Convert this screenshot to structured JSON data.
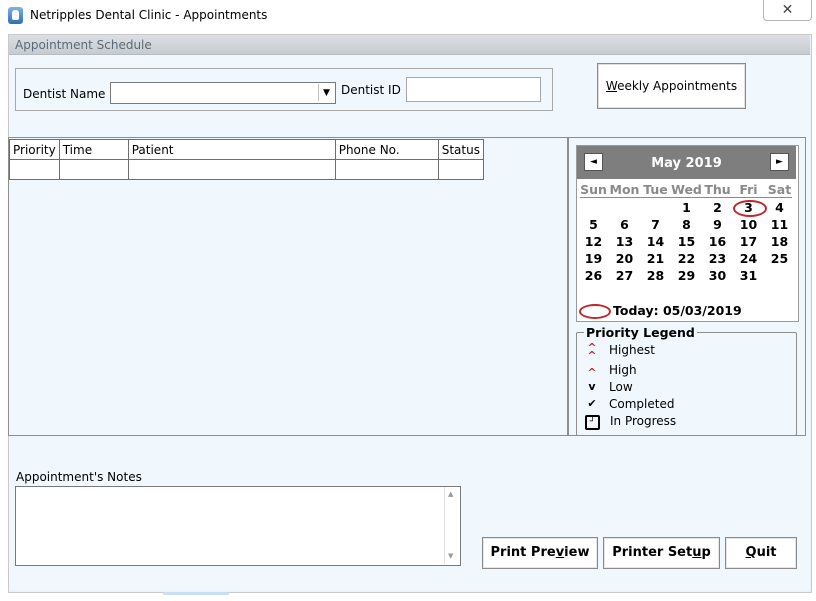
{
  "window": {
    "title": "Netripples Dental Clinic - Appointments",
    "close_glyph": "✕"
  },
  "schedule": {
    "header": "Appointment Schedule"
  },
  "dentist": {
    "name_label": "Dentist Name",
    "name_value": "",
    "id_label": "Dentist ID",
    "id_value": ""
  },
  "weekly_button": {
    "mnemonic": "W",
    "rest": "eekly Appointments"
  },
  "table": {
    "columns": [
      "Priority",
      "Time",
      "Patient",
      "Phone No.",
      "Status"
    ],
    "rows": [
      [
        "",
        "",
        "",
        "",
        ""
      ]
    ]
  },
  "calendar": {
    "month_label": "May 2019",
    "prev_glyph": "◄",
    "next_glyph": "►",
    "days_of_week": [
      "Sun",
      "Mon",
      "Tue",
      "Wed",
      "Thu",
      "Fri",
      "Sat"
    ],
    "weeks": [
      [
        "",
        "",
        "",
        "1",
        "2",
        "3",
        "4"
      ],
      [
        "5",
        "6",
        "7",
        "8",
        "9",
        "10",
        "11"
      ],
      [
        "12",
        "13",
        "14",
        "15",
        "16",
        "17",
        "18"
      ],
      [
        "19",
        "20",
        "21",
        "22",
        "23",
        "24",
        "25"
      ],
      [
        "26",
        "27",
        "28",
        "29",
        "30",
        "31",
        ""
      ]
    ],
    "today_text": "Today: 05/03/2019",
    "highlight_color": "#c0272d"
  },
  "legend": {
    "title": "Priority Legend",
    "items": [
      {
        "label": "Highest",
        "icon": "double-caret-up-icon",
        "glyph": "⌃",
        "color": "#d0202a"
      },
      {
        "label": "High",
        "icon": "caret-up-icon",
        "glyph": "^",
        "color": "#d0202a"
      },
      {
        "label": "Low",
        "icon": "caret-down-icon",
        "glyph": "v",
        "color": "#000000"
      },
      {
        "label": "Completed",
        "icon": "checkmark-icon",
        "glyph": "✔",
        "color": "#000000"
      },
      {
        "label": "In Progress",
        "icon": "clock-icon",
        "glyph": "◷",
        "color": "#000000"
      }
    ]
  },
  "notes": {
    "label": "Appointment's Notes",
    "value": ""
  },
  "buttons": {
    "print_preview": {
      "before": "Print Pre",
      "mnemonic": "v",
      "after": "iew"
    },
    "printer_setup": {
      "before": "Printer Set",
      "mnemonic": "u",
      "after": "p"
    },
    "quit": {
      "before": "",
      "mnemonic": "Q",
      "after": "uit"
    }
  }
}
